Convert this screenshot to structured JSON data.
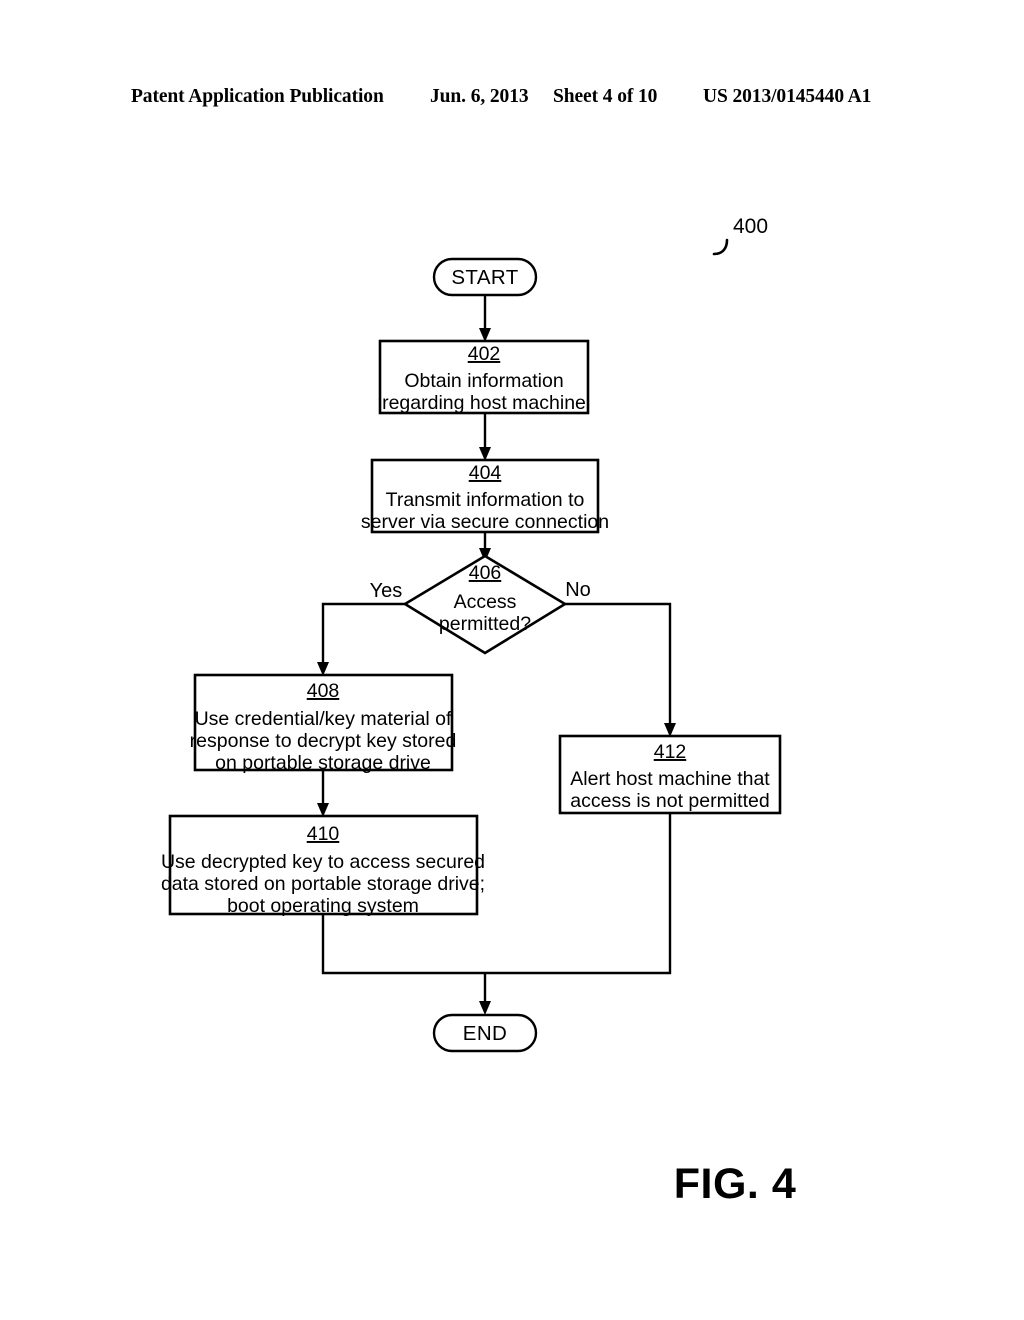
{
  "header": {
    "publication": "Patent Application Publication",
    "date": "Jun. 6, 2013",
    "sheet": "Sheet 4 of 10",
    "patent_number": "US 2013/0145440 A1"
  },
  "figure": {
    "reference_numeral": "400",
    "caption": "FIG. 4",
    "terminals": {
      "start": "START",
      "end": "END"
    },
    "branches": {
      "yes": "Yes",
      "no": "No"
    },
    "steps": [
      {
        "id": "402",
        "lines": [
          "Obtain information",
          "regarding host machine"
        ]
      },
      {
        "id": "404",
        "lines": [
          "Transmit information to",
          "server via secure connection"
        ]
      },
      {
        "id": "406",
        "lines": [
          "Access",
          "permitted?"
        ]
      },
      {
        "id": "408",
        "lines": [
          "Use credential/key material of",
          "response to decrypt key stored",
          "on portable storage drive"
        ]
      },
      {
        "id": "410",
        "lines": [
          "Use decrypted key to access secured",
          "data stored on portable storage drive;",
          "boot operating system"
        ]
      },
      {
        "id": "412",
        "lines": [
          "Alert host machine that",
          "access is not permitted"
        ]
      }
    ]
  },
  "colors": {
    "ink": "#000000",
    "paper": "#ffffff"
  }
}
